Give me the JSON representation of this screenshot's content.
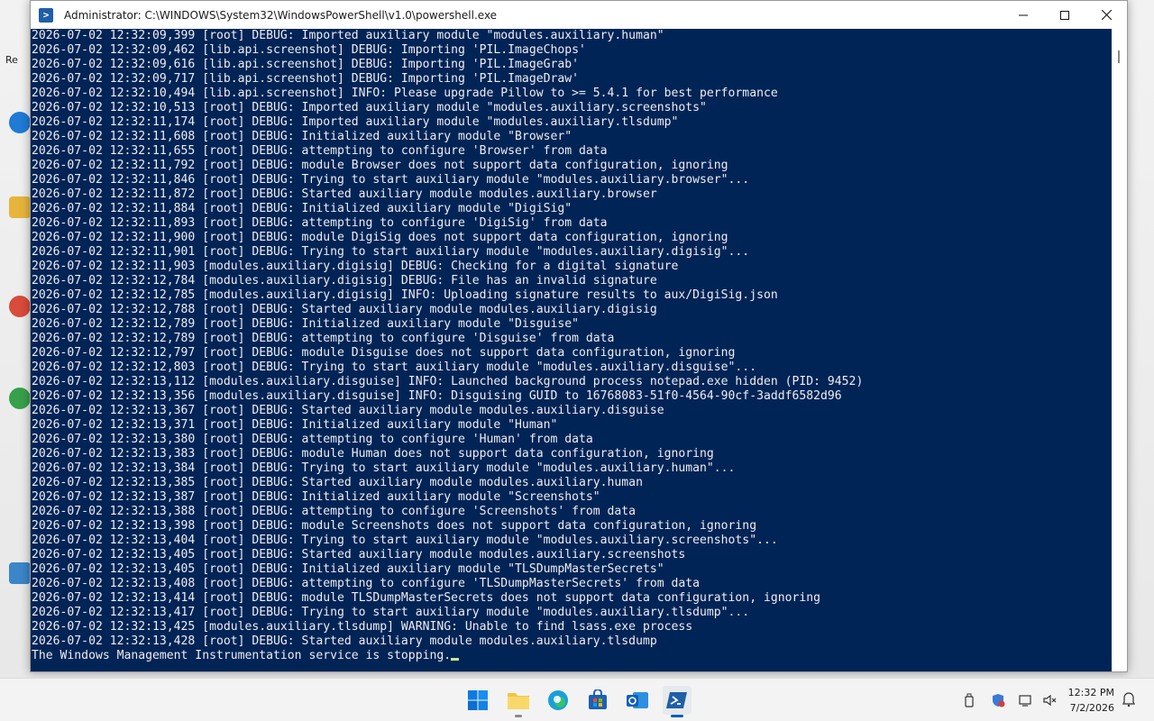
{
  "window": {
    "title": "Administrator: C:\\WINDOWS\\System32\\WindowsPowerShell\\v1.0\\powershell.exe",
    "icon": "powershell-icon",
    "controls": {
      "minimize": "—",
      "maximize": "☐",
      "close": "✕"
    }
  },
  "console": {
    "lines": [
      "2026-07-02 12:32:09,399 [root] DEBUG: Imported auxiliary module \"modules.auxiliary.human\"",
      "2026-07-02 12:32:09,462 [lib.api.screenshot] DEBUG: Importing 'PIL.ImageChops'",
      "2026-07-02 12:32:09,616 [lib.api.screenshot] DEBUG: Importing 'PIL.ImageGrab'",
      "2026-07-02 12:32:09,717 [lib.api.screenshot] DEBUG: Importing 'PIL.ImageDraw'",
      "2026-07-02 12:32:10,494 [lib.api.screenshot] INFO: Please upgrade Pillow to >= 5.4.1 for best performance",
      "2026-07-02 12:32:10,513 [root] DEBUG: Imported auxiliary module \"modules.auxiliary.screenshots\"",
      "2026-07-02 12:32:11,174 [root] DEBUG: Imported auxiliary module \"modules.auxiliary.tlsdump\"",
      "2026-07-02 12:32:11,608 [root] DEBUG: Initialized auxiliary module \"Browser\"",
      "2026-07-02 12:32:11,655 [root] DEBUG: attempting to configure 'Browser' from data",
      "2026-07-02 12:32:11,792 [root] DEBUG: module Browser does not support data configuration, ignoring",
      "2026-07-02 12:32:11,846 [root] DEBUG: Trying to start auxiliary module \"modules.auxiliary.browser\"...",
      "2026-07-02 12:32:11,872 [root] DEBUG: Started auxiliary module modules.auxiliary.browser",
      "2026-07-02 12:32:11,884 [root] DEBUG: Initialized auxiliary module \"DigiSig\"",
      "2026-07-02 12:32:11,893 [root] DEBUG: attempting to configure 'DigiSig' from data",
      "2026-07-02 12:32:11,900 [root] DEBUG: module DigiSig does not support data configuration, ignoring",
      "2026-07-02 12:32:11,901 [root] DEBUG: Trying to start auxiliary module \"modules.auxiliary.digisig\"...",
      "2026-07-02 12:32:11,903 [modules.auxiliary.digisig] DEBUG: Checking for a digital signature",
      "2026-07-02 12:32:12,784 [modules.auxiliary.digisig] DEBUG: File has an invalid signature",
      "2026-07-02 12:32:12,785 [modules.auxiliary.digisig] INFO: Uploading signature results to aux/DigiSig.json",
      "2026-07-02 12:32:12,788 [root] DEBUG: Started auxiliary module modules.auxiliary.digisig",
      "2026-07-02 12:32:12,789 [root] DEBUG: Initialized auxiliary module \"Disguise\"",
      "2026-07-02 12:32:12,789 [root] DEBUG: attempting to configure 'Disguise' from data",
      "2026-07-02 12:32:12,797 [root] DEBUG: module Disguise does not support data configuration, ignoring",
      "2026-07-02 12:32:12,803 [root] DEBUG: Trying to start auxiliary module \"modules.auxiliary.disguise\"...",
      "2026-07-02 12:32:13,112 [modules.auxiliary.disguise] INFO: Launched background process notepad.exe hidden (PID: 9452)",
      "2026-07-02 12:32:13,356 [modules.auxiliary.disguise] INFO: Disguising GUID to 16768083-51f0-4564-90cf-3addf6582d96",
      "2026-07-02 12:32:13,367 [root] DEBUG: Started auxiliary module modules.auxiliary.disguise",
      "2026-07-02 12:32:13,371 [root] DEBUG: Initialized auxiliary module \"Human\"",
      "2026-07-02 12:32:13,380 [root] DEBUG: attempting to configure 'Human' from data",
      "2026-07-02 12:32:13,383 [root] DEBUG: module Human does not support data configuration, ignoring",
      "2026-07-02 12:32:13,384 [root] DEBUG: Trying to start auxiliary module \"modules.auxiliary.human\"...",
      "2026-07-02 12:32:13,385 [root] DEBUG: Started auxiliary module modules.auxiliary.human",
      "2026-07-02 12:32:13,387 [root] DEBUG: Initialized auxiliary module \"Screenshots\"",
      "2026-07-02 12:32:13,388 [root] DEBUG: attempting to configure 'Screenshots' from data",
      "2026-07-02 12:32:13,398 [root] DEBUG: module Screenshots does not support data configuration, ignoring",
      "2026-07-02 12:32:13,404 [root] DEBUG: Trying to start auxiliary module \"modules.auxiliary.screenshots\"...",
      "2026-07-02 12:32:13,405 [root] DEBUG: Started auxiliary module modules.auxiliary.screenshots",
      "2026-07-02 12:32:13,405 [root] DEBUG: Initialized auxiliary module \"TLSDumpMasterSecrets\"",
      "2026-07-02 12:32:13,408 [root] DEBUG: attempting to configure 'TLSDumpMasterSecrets' from data",
      "2026-07-02 12:32:13,414 [root] DEBUG: module TLSDumpMasterSecrets does not support data configuration, ignoring",
      "2026-07-02 12:32:13,417 [root] DEBUG: Trying to start auxiliary module \"modules.auxiliary.tlsdump\"...",
      "2026-07-02 12:32:13,425 [modules.auxiliary.tlsdump] WARNING: Unable to find lsass.exe process",
      "2026-07-02 12:32:13,428 [root] DEBUG: Started auxiliary module modules.auxiliary.tlsdump",
      "The Windows Management Instrumentation service is stopping."
    ],
    "background": "#012456",
    "foreground": "#eeedf0"
  },
  "taskbar": {
    "apps": [
      {
        "name": "start-button",
        "icon": "windows-logo-icon"
      },
      {
        "name": "file-explorer",
        "icon": "folder-icon"
      },
      {
        "name": "edge",
        "icon": "edge-icon"
      },
      {
        "name": "microsoft-store",
        "icon": "store-icon"
      },
      {
        "name": "outlook",
        "icon": "outlook-icon"
      },
      {
        "name": "powershell",
        "icon": "powershell-icon"
      }
    ],
    "clock": {
      "time": "12:32 PM",
      "date": "7/2/2026"
    }
  }
}
